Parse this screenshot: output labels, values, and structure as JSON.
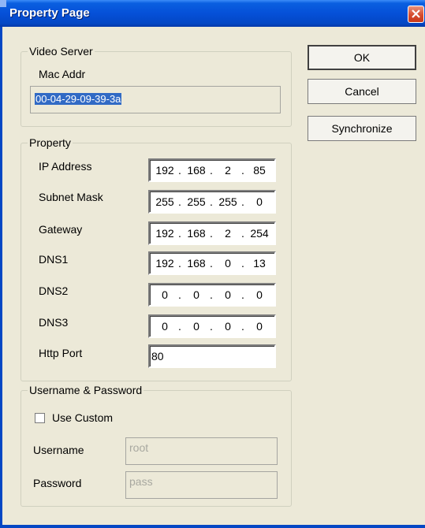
{
  "window": {
    "title": "Property Page"
  },
  "video_server": {
    "legend": "Video Server",
    "mac_label": "Mac Addr",
    "mac_value": "00-04-29-09-39-3a"
  },
  "property": {
    "legend": "Property",
    "fields": [
      {
        "label": "IP Address",
        "octets": [
          "192",
          "168",
          "2",
          "85"
        ]
      },
      {
        "label": "Subnet Mask",
        "octets": [
          "255",
          "255",
          "255",
          "0"
        ]
      },
      {
        "label": "Gateway",
        "octets": [
          "192",
          "168",
          "2",
          "254"
        ]
      },
      {
        "label": "DNS1",
        "octets": [
          "192",
          "168",
          "0",
          "13"
        ]
      },
      {
        "label": "DNS2",
        "octets": [
          "0",
          "0",
          "0",
          "0"
        ]
      },
      {
        "label": "DNS3",
        "octets": [
          "0",
          "0",
          "0",
          "0"
        ]
      }
    ],
    "http_port_label": "Http Port",
    "http_port_value": "80"
  },
  "credentials": {
    "legend": "Username & Password",
    "use_custom_label": "Use Custom",
    "use_custom_checked": false,
    "username_label": "Username",
    "username_value": "root",
    "password_label": "Password",
    "password_value": "pass"
  },
  "buttons": {
    "ok": "OK",
    "cancel": "Cancel",
    "synchronize": "Synchronize"
  },
  "colors": {
    "title_bar": "#0550D8",
    "dialog_bg": "#ECE9D8",
    "selection": "#316AC5",
    "close_button": "#D64C2E"
  }
}
